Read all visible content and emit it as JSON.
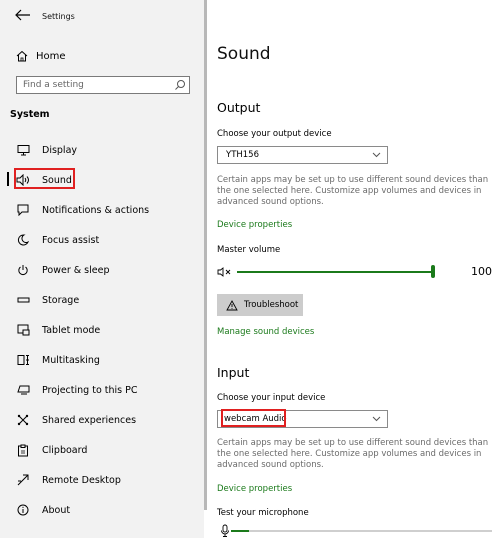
{
  "window": {
    "title": "Settings"
  },
  "sidebar": {
    "home_label": "Home",
    "search_placeholder": "Find a setting",
    "section_label": "System",
    "items": [
      {
        "label": "Display",
        "icon": "monitor-icon"
      },
      {
        "label": "Sound",
        "icon": "speaker-icon",
        "selected": true
      },
      {
        "label": "Notifications & actions",
        "icon": "notification-icon"
      },
      {
        "label": "Focus assist",
        "icon": "moon-icon"
      },
      {
        "label": "Power & sleep",
        "icon": "power-icon"
      },
      {
        "label": "Storage",
        "icon": "storage-icon"
      },
      {
        "label": "Tablet mode",
        "icon": "tablet-icon"
      },
      {
        "label": "Multitasking",
        "icon": "multitasking-icon"
      },
      {
        "label": "Projecting to this PC",
        "icon": "projector-icon"
      },
      {
        "label": "Shared experiences",
        "icon": "share-icon"
      },
      {
        "label": "Clipboard",
        "icon": "clipboard-icon"
      },
      {
        "label": "Remote Desktop",
        "icon": "remote-desktop-icon"
      },
      {
        "label": "About",
        "icon": "info-icon"
      }
    ]
  },
  "main": {
    "title": "Sound",
    "output": {
      "heading": "Output",
      "choose_label": "Choose your output device",
      "device": "YTH156",
      "description": "Certain apps may be set up to use different sound devices than the one selected here. Customize app volumes and devices in advanced sound options.",
      "device_properties": "Device properties",
      "master_volume_label": "Master volume",
      "volume_value": "100",
      "volume_level": 1.0,
      "troubleshoot_label": "Troubleshoot",
      "manage_devices": "Manage sound devices"
    },
    "input": {
      "heading": "Input",
      "choose_label": "Choose your input device",
      "device": "webcam Audio",
      "description": "Certain apps may be set up to use different sound devices than the one selected here. Customize app volumes and devices in advanced sound options.",
      "device_properties": "Device properties",
      "test_label": "Test your microphone",
      "mic_level": 0.07
    }
  },
  "colors": {
    "accent": "#1b7a1b",
    "highlight": "#e02020",
    "sidebar_bg": "#f2f2f2"
  }
}
